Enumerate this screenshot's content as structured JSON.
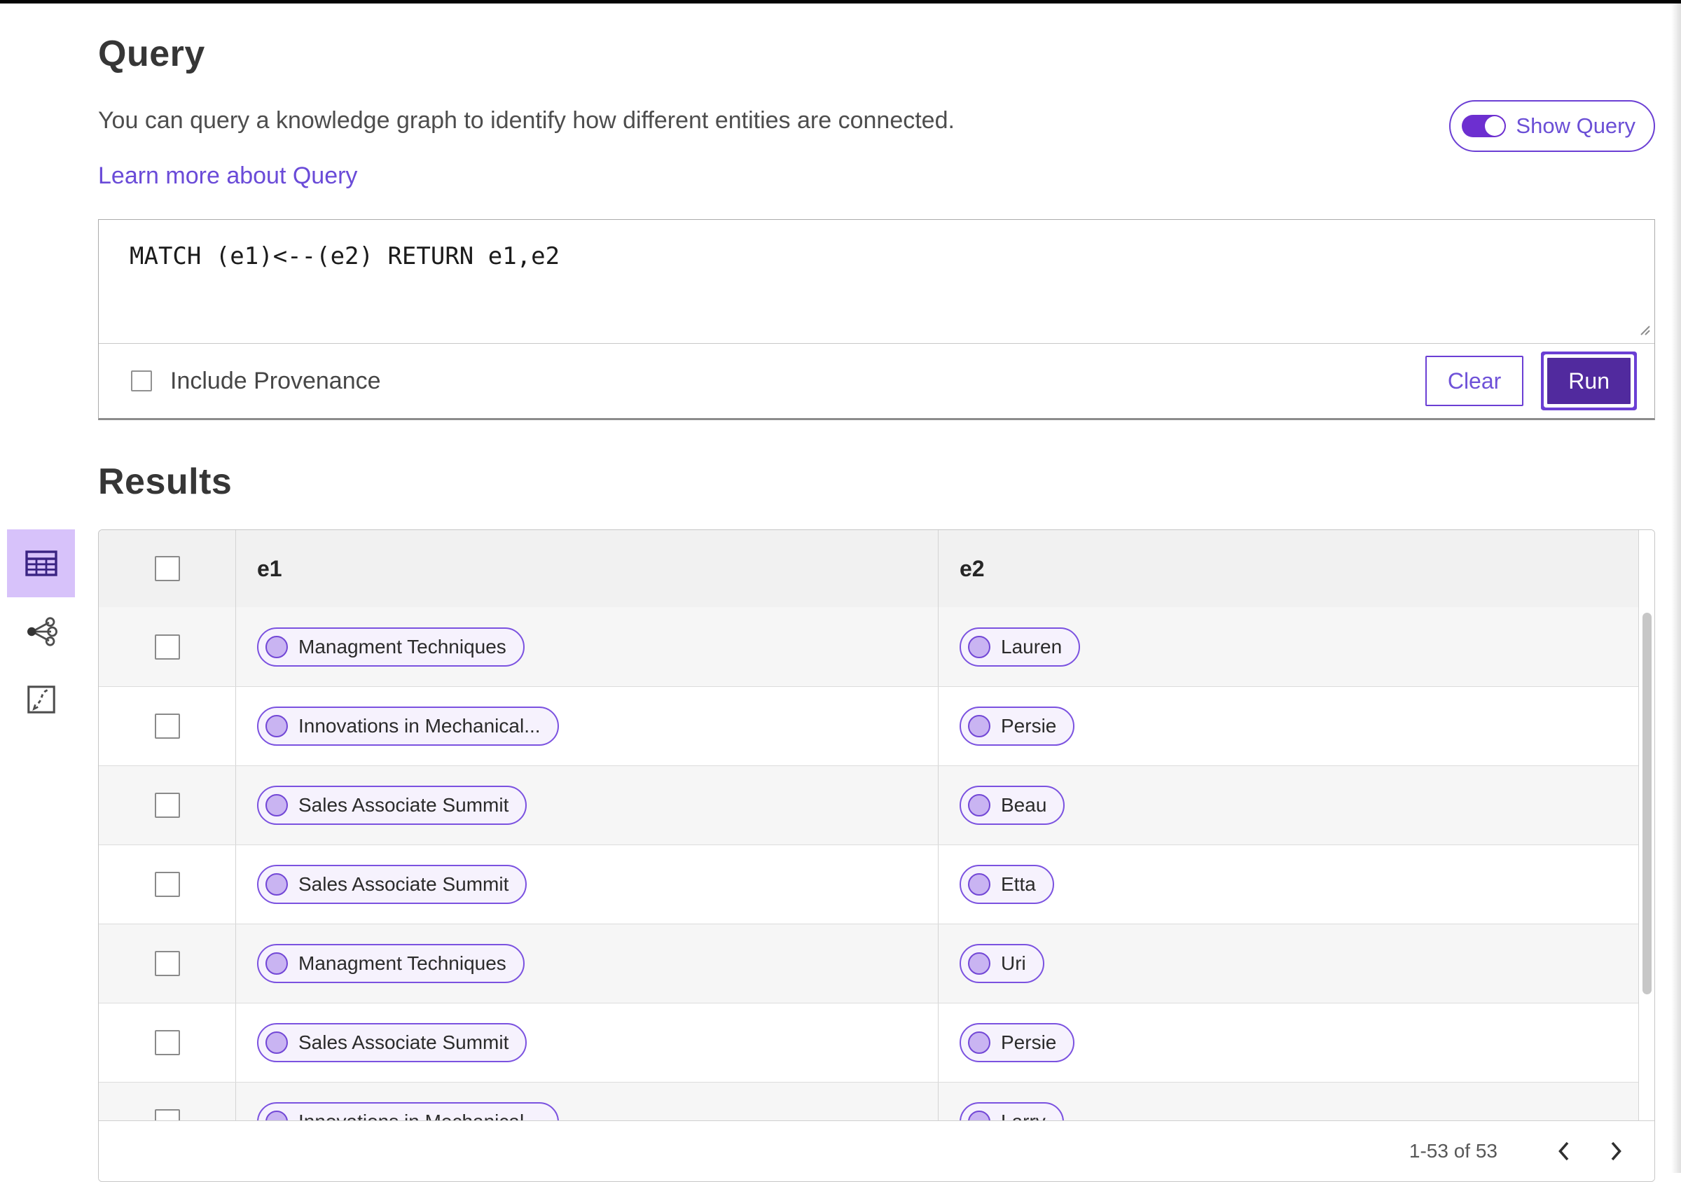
{
  "query_section": {
    "title": "Query",
    "description": "You can query a knowledge graph to identify how different entities are connected.",
    "learn_more_link": "Learn more about Query",
    "show_query_toggle": {
      "label": "Show Query",
      "enabled": true
    },
    "editor": {
      "value": "MATCH (e1)<--(e2) RETURN e1,e2"
    },
    "include_provenance": {
      "label": "Include Provenance",
      "checked": false
    },
    "buttons": {
      "clear": "Clear",
      "run": "Run"
    }
  },
  "results_section": {
    "title": "Results",
    "view_switcher": [
      {
        "name": "table-view",
        "icon": "table-icon",
        "selected": true
      },
      {
        "name": "graph-view",
        "icon": "network-icon",
        "selected": false
      },
      {
        "name": "expand-view",
        "icon": "expand-icon",
        "selected": false
      }
    ],
    "table": {
      "columns": [
        "e1",
        "e2"
      ],
      "select_all_checked": false,
      "rows": [
        {
          "e1": "Managment Techniques",
          "e2": "Lauren"
        },
        {
          "e1": "Innovations in Mechanical...",
          "e2": "Persie"
        },
        {
          "e1": "Sales Associate Summit",
          "e2": "Beau"
        },
        {
          "e1": "Sales Associate Summit",
          "e2": "Etta"
        },
        {
          "e1": "Managment Techniques",
          "e2": "Uri"
        },
        {
          "e1": "Sales Associate Summit",
          "e2": "Persie"
        },
        {
          "e1": "Innovations in Mechanical...",
          "e2": "Larry"
        }
      ]
    },
    "pagination": {
      "range_label": "1-53 of 53"
    }
  },
  "colors": {
    "accent_purple": "#6b3fd4",
    "run_button_fill": "#512a9e",
    "toggle_fill": "#6d2fd0",
    "link_purple": "#6a4bd8",
    "pill_border": "#7b52e0",
    "pill_background": "#f6f2fd",
    "pill_dot_fill": "#c9b4f2",
    "selected_rail_background": "#d7c2fa",
    "table_header_background": "#f1f1f1",
    "row_stripe": "#f6f6f6"
  }
}
